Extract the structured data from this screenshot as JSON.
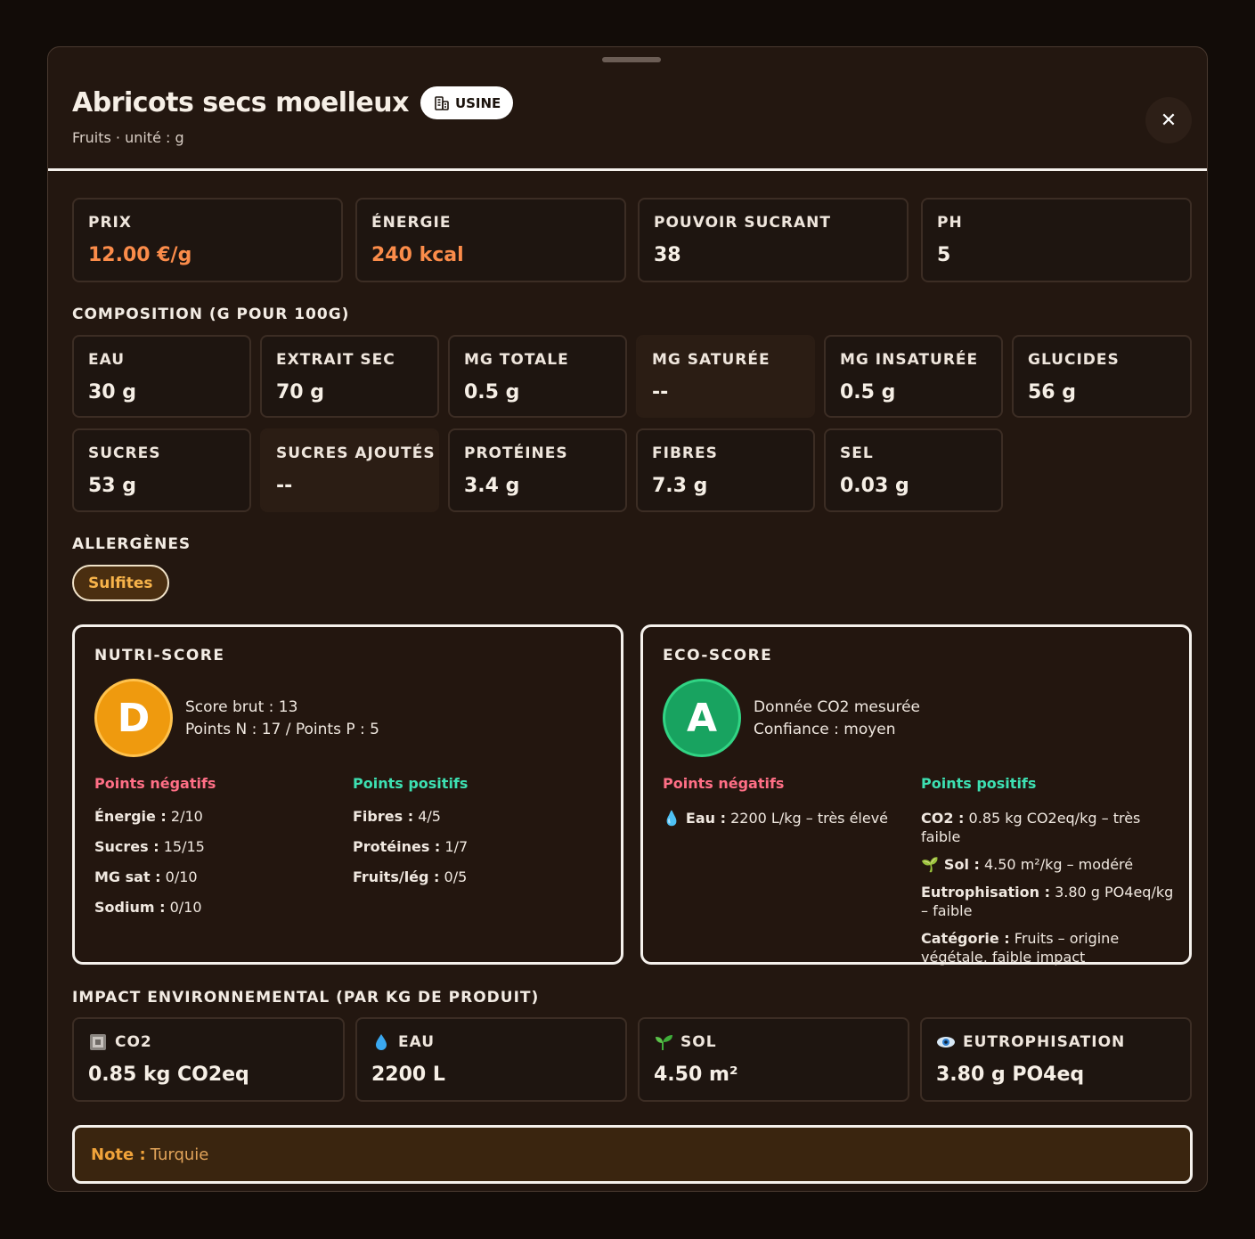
{
  "header": {
    "title": "Abricots secs moelleux",
    "badge": "USINE",
    "badge_icon": "factory-icon",
    "subtitle": "Fruits · unité : g",
    "close_label": "✕"
  },
  "stats": [
    {
      "label": "PRIX",
      "value": "12.00 €/g",
      "accent": "#fb8c4a"
    },
    {
      "label": "ÉNERGIE",
      "value": "240 kcal",
      "accent": "#fb8c4a"
    },
    {
      "label": "POUVOIR SUCRANT",
      "value": "38"
    },
    {
      "label": "PH",
      "value": "5"
    }
  ],
  "composition": {
    "title": "COMPOSITION (G POUR 100G)",
    "items": [
      {
        "label": "EAU",
        "value": "30 g"
      },
      {
        "label": "EXTRAIT SEC",
        "value": "70 g"
      },
      {
        "label": "MG TOTALE",
        "value": "0.5 g"
      },
      {
        "label": "MG SATURÉE",
        "value": "--"
      },
      {
        "label": "MG INSATURÉE",
        "value": "0.5 g"
      },
      {
        "label": "GLUCIDES",
        "value": "56 g"
      },
      {
        "label": "SUCRES",
        "value": "53 g"
      },
      {
        "label": "SUCRES AJOUTÉS",
        "value": "--"
      },
      {
        "label": "PROTÉINES",
        "value": "3.4 g"
      },
      {
        "label": "FIBRES",
        "value": "7.3 g"
      },
      {
        "label": "SEL",
        "value": "0.03 g"
      }
    ]
  },
  "allergens": {
    "title": "ALLERGÈNES",
    "items": [
      "Sulfites"
    ]
  },
  "nutri": {
    "title": "NUTRI-SCORE",
    "grade": "D",
    "grade_color": "#ef9a0e",
    "line1": "Score brut : 13",
    "line2": "Points N : 17 / Points P : 5",
    "neg_title": "Points négatifs",
    "pos_title": "Points positifs",
    "neg": [
      {
        "k": "Énergie :",
        "v": "2/10"
      },
      {
        "k": "Sucres :",
        "v": "15/15"
      },
      {
        "k": "MG sat :",
        "v": "0/10"
      },
      {
        "k": "Sodium :",
        "v": "0/10"
      }
    ],
    "pos": [
      {
        "k": "Fibres :",
        "v": "4/5"
      },
      {
        "k": "Protéines :",
        "v": "1/7"
      },
      {
        "k": "Fruits/lég :",
        "v": "0/5"
      }
    ]
  },
  "eco": {
    "title": "ECO-SCORE",
    "grade": "A",
    "grade_color": "#18a360",
    "line1": "Donnée CO2 mesurée",
    "line2": "Confiance : moyen",
    "neg_title": "Points négatifs",
    "pos_title": "Points positifs",
    "neg": [
      {
        "icon": "💧",
        "k": "Eau :",
        "v": "2200 L/kg – très élevé"
      }
    ],
    "pos": [
      {
        "icon": "",
        "k": "CO2 :",
        "v": "0.85 kg CO2eq/kg – très faible"
      },
      {
        "icon": "🌱",
        "k": "Sol :",
        "v": "4.50 m²/kg – modéré"
      },
      {
        "icon": "",
        "k": "Eutrophisation :",
        "v": "3.80 g PO4eq/kg – faible"
      },
      {
        "icon": "",
        "k": "Catégorie :",
        "v": "Fruits – origine végétale, faible impact"
      }
    ]
  },
  "impact": {
    "title": "IMPACT ENVIRONNEMENTAL (PAR KG DE PRODUIT)",
    "items": [
      {
        "icon": "factory-icon",
        "label": "CO2",
        "value": "0.85 kg CO2eq"
      },
      {
        "icon": "droplet-icon",
        "label": "EAU",
        "value": "2200 L"
      },
      {
        "icon": "seedling-icon",
        "label": "SOL",
        "value": "4.50 m²"
      },
      {
        "icon": "eye-icon",
        "label": "EUTROPHISATION",
        "value": "3.80 g PO4eq"
      }
    ]
  },
  "note": {
    "key": "Note :",
    "value": "Turquie"
  }
}
